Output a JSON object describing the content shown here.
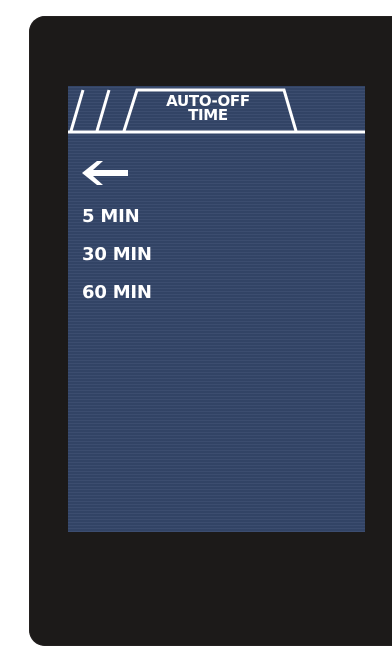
{
  "header": {
    "title_line1": "AUTO-OFF",
    "title_line2": "TIME"
  },
  "navigation": {
    "back_icon": "left-arrow-icon"
  },
  "menu": {
    "items": [
      {
        "label": "5 MIN"
      },
      {
        "label": "30 MIN"
      },
      {
        "label": "60 MIN"
      }
    ]
  },
  "colors": {
    "device_body": "#1c1a19",
    "screen_background": "#35476a",
    "foreground": "#ffffff"
  }
}
